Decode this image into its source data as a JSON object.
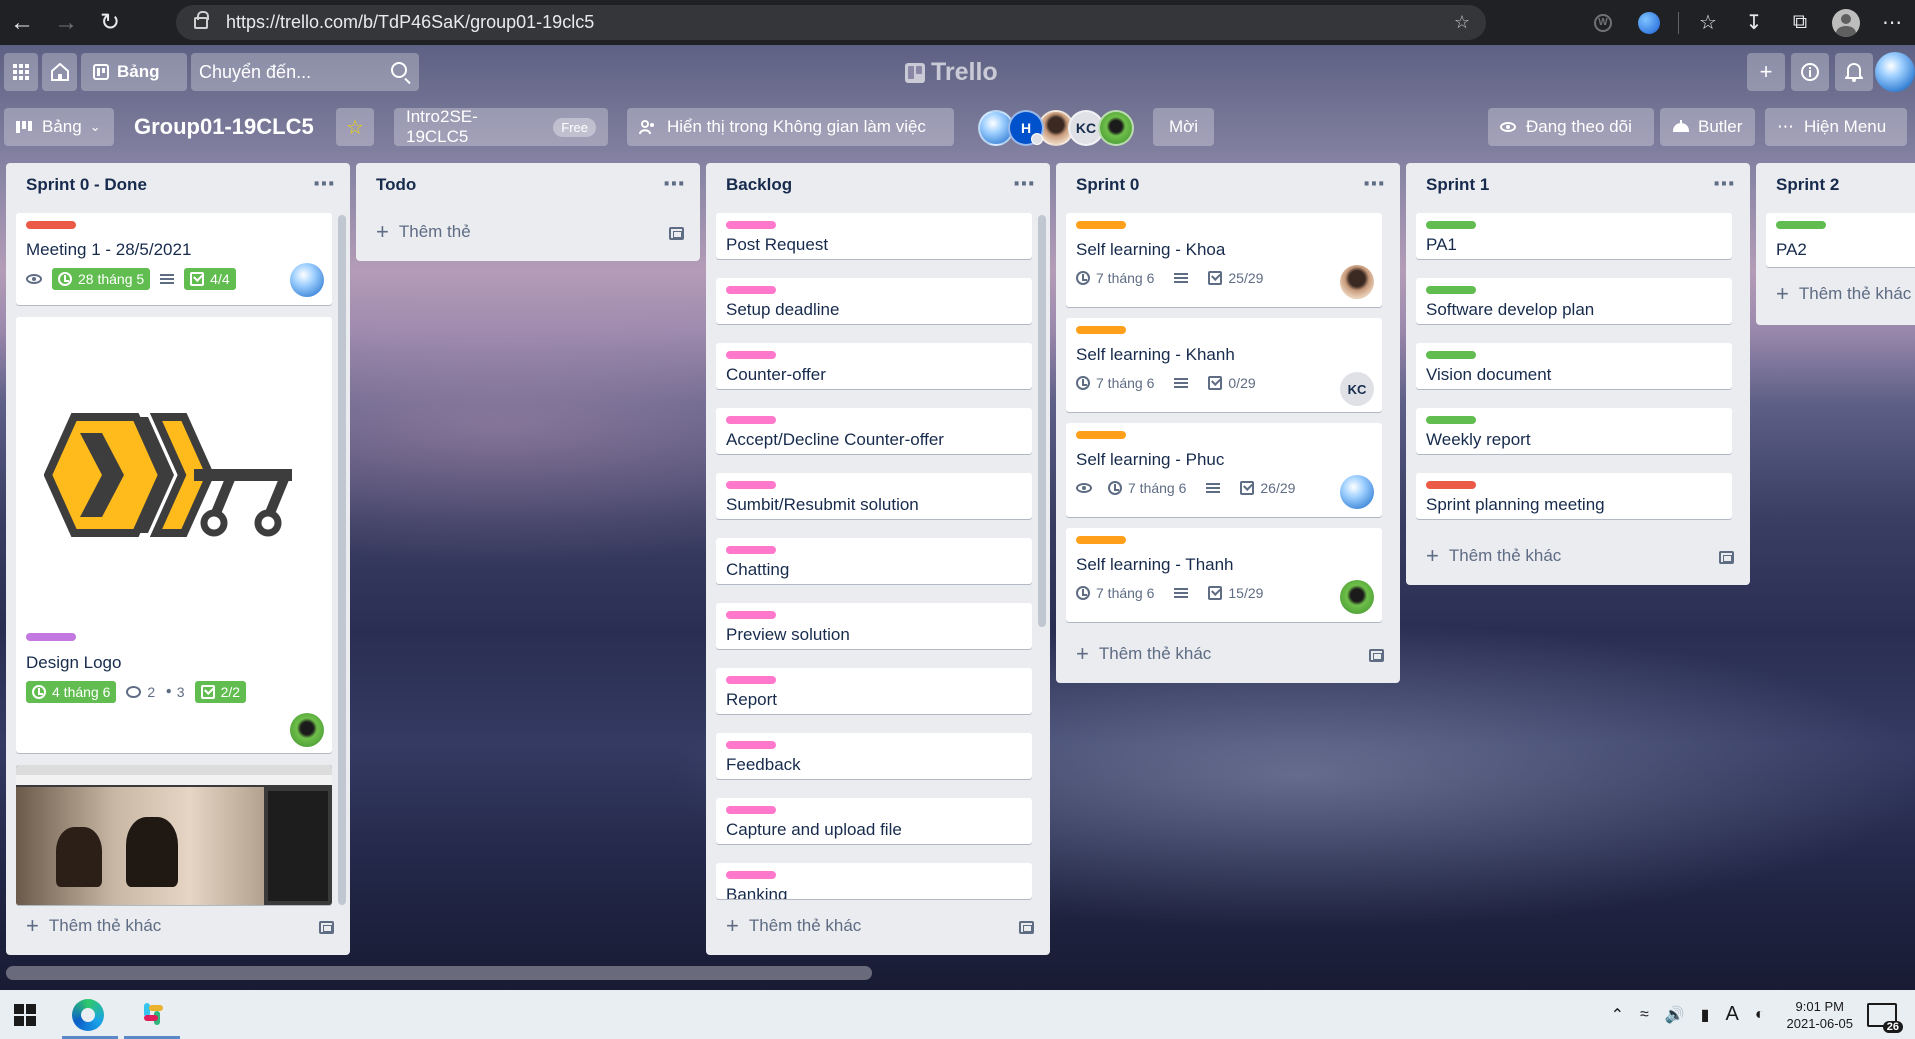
{
  "browser": {
    "url": "https://trello.com/b/TdP46SaK/group01-19clc5"
  },
  "header": {
    "boards_label": "Bảng",
    "search_placeholder": "Chuyển đến...",
    "logo_text": "Trello"
  },
  "board": {
    "view_label": "Bảng",
    "name": "Group01-19CLC5",
    "workspace": "Intro2SE-19CLC5",
    "workspace_badge": "Free",
    "visibility": "Hiển thị trong Không gian làm việc",
    "member_kc": "KC",
    "member_h": "H",
    "invite_label": "Mời",
    "watching_label": "Đang theo dõi",
    "butler_label": "Butler",
    "menu_label": "Hiện Menu"
  },
  "lists": [
    {
      "title": "Sprint 0 - Done",
      "add_label": "Thêm thẻ khác",
      "cards": [
        {
          "label_color": "#eb5a46",
          "title": "Meeting 1 - 28/5/2021",
          "due": "28 tháng 5",
          "checklist": "4/4"
        },
        {
          "label_color": "#c377e0",
          "title": "Design Logo",
          "due": "4 tháng 6",
          "comments": "2",
          "attachments": "3",
          "checklist": "2/2"
        }
      ]
    },
    {
      "title": "Todo",
      "add_label": "Thêm thẻ",
      "cards": []
    },
    {
      "title": "Backlog",
      "add_label": "Thêm thẻ khác",
      "cards": [
        {
          "label_color": "#ff78cb",
          "title": "Post Request"
        },
        {
          "label_color": "#ff78cb",
          "title": "Setup deadline"
        },
        {
          "label_color": "#ff78cb",
          "title": "Counter-offer"
        },
        {
          "label_color": "#ff78cb",
          "title": "Accept/Decline Counter-offer"
        },
        {
          "label_color": "#ff78cb",
          "title": "Sumbit/Resubmit solution"
        },
        {
          "label_color": "#ff78cb",
          "title": "Chatting"
        },
        {
          "label_color": "#ff78cb",
          "title": "Preview solution"
        },
        {
          "label_color": "#ff78cb",
          "title": "Report"
        },
        {
          "label_color": "#ff78cb",
          "title": "Feedback"
        },
        {
          "label_color": "#ff78cb",
          "title": "Capture and upload file"
        },
        {
          "label_color": "#ff78cb",
          "title": "Banking"
        }
      ]
    },
    {
      "title": "Sprint 0",
      "add_label": "Thêm thẻ khác",
      "cards": [
        {
          "label_color": "#ff9f1a",
          "title": "Self learning - Khoa",
          "due": "7 tháng 6",
          "checklist": "25/29"
        },
        {
          "label_color": "#ff9f1a",
          "title": "Self learning - Khanh",
          "due": "7 tháng 6",
          "checklist": "0/29",
          "member": "KC"
        },
        {
          "label_color": "#ff9f1a",
          "title": "Self learning - Phuc",
          "due": "7 tháng 6",
          "checklist": "26/29"
        },
        {
          "label_color": "#ff9f1a",
          "title": "Self learning - Thanh",
          "due": "7 tháng 6",
          "checklist": "15/29"
        }
      ]
    },
    {
      "title": "Sprint 1",
      "add_label": "Thêm thẻ khác",
      "cards": [
        {
          "label_color": "#61bd4f",
          "title": "PA1"
        },
        {
          "label_color": "#61bd4f",
          "title": "Software develop plan"
        },
        {
          "label_color": "#61bd4f",
          "title": "Vision document"
        },
        {
          "label_color": "#61bd4f",
          "title": "Weekly report"
        },
        {
          "label_color": "#eb5a46",
          "title": "Sprint planning meeting"
        }
      ]
    },
    {
      "title": "Sprint 2",
      "add_label": "Thêm thẻ khác",
      "cards": [
        {
          "label_color": "#61bd4f",
          "title": "PA2"
        }
      ]
    }
  ],
  "taskbar": {
    "time": "9:01 PM",
    "date": "2021-06-05",
    "notifications": "26",
    "lang": "A"
  }
}
